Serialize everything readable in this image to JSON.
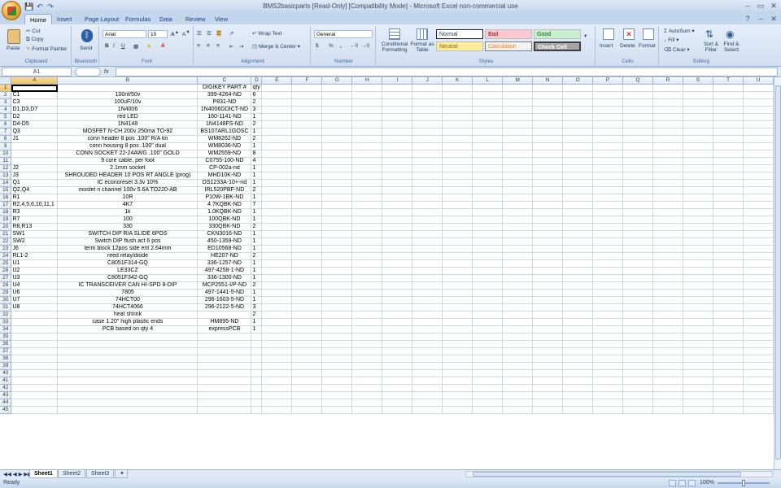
{
  "window": {
    "title": "BMS2basicparts  [Read-Only]  [Compatibility Mode] - Microsoft Excel non-commercial use",
    "minimize": "–",
    "maximize": "▭",
    "close": "✕"
  },
  "tabs": [
    "Home",
    "Insert",
    "Page Layout",
    "Formulas",
    "Data",
    "Review",
    "View"
  ],
  "active_tab": "Home",
  "ribbon": {
    "clipboard": {
      "label": "Clipboard",
      "paste": "Paste",
      "cut": "Cut",
      "copy": "Copy",
      "format_painter": "Format Painter"
    },
    "bluetooth": {
      "label": "Bluetooth",
      "send": "Send"
    },
    "font": {
      "label": "Font",
      "name": "Arial",
      "size": "10"
    },
    "alignment": {
      "label": "Alignment",
      "wrap": "Wrap Text",
      "merge": "Merge & Center"
    },
    "number": {
      "label": "Number",
      "format": "General",
      "currency": "$",
      "percent": "%",
      "comma": ","
    },
    "styles": {
      "label": "Styles",
      "conditional": "Conditional Formatting",
      "format_table": "Format as Table",
      "normal": "Normal",
      "bad": "Bad",
      "good": "Good",
      "neutral": "Neutral",
      "calculation": "Calculation",
      "check_cell": "Check Cell"
    },
    "cells": {
      "label": "Cells",
      "insert": "Insert",
      "delete": "Delete",
      "format": "Format"
    },
    "editing": {
      "label": "Editing",
      "autosum": "AutoSum",
      "fill": "Fill",
      "clear": "Clear",
      "sort": "Sort & Filter",
      "find": "Find & Select"
    }
  },
  "formula_bar": {
    "name_box": "A1",
    "fx": "fx",
    "value": ""
  },
  "columns": [
    "A",
    "B",
    "C",
    "D",
    "E",
    "F",
    "G",
    "H",
    "I",
    "J",
    "K",
    "L",
    "M",
    "N",
    "O",
    "P",
    "Q",
    "R",
    "S",
    "T",
    "U"
  ],
  "rows": [
    [
      "",
      "",
      "DIGIKEY PART #",
      "qty"
    ],
    [
      "C1",
      "100nf/50v",
      "399-4264-ND",
      "6"
    ],
    [
      "C3",
      "100uF/10v",
      "P831-ND",
      "2"
    ],
    [
      "D1,D3,D7",
      "1N4006",
      "1N4006GDICT-ND",
      "3"
    ],
    [
      "D2",
      "red LED",
      "160-1141-ND",
      "1"
    ],
    [
      "D4-D5",
      "1N4148",
      "1N4148FS-ND",
      "2"
    ],
    [
      "Q3",
      "MOSFET N-CH 200v 250ma TO-92",
      "BS107ARL1GOSC",
      "1"
    ],
    [
      "J1",
      "conn header 8 pos .100\" R/A tin",
      "WM8262-ND",
      "2"
    ],
    [
      "",
      "conn housing 8 pos .100\" dual",
      "WM8036-ND",
      "1"
    ],
    [
      "",
      "CONN SOCKET 22-24AWG .100\" GOLD",
      "WM2559-ND",
      "8"
    ],
    [
      "",
      "9 core cable, per foot",
      "C0755-100-ND",
      "4"
    ],
    [
      "J2",
      "2.1mm socket",
      "CP-002a-nd",
      "1"
    ],
    [
      "J3",
      "SHROUDED HEADER 10 POS RT ANGLE (prog)",
      "MHD10K-ND",
      "1"
    ],
    [
      "Q1",
      "IC econoreset 3.3v 10%",
      "DS1233A-10+-nd",
      "1"
    ],
    [
      "Q2,Q4",
      "mosfet n channel 100v 5.6A TO220-AB",
      "IRL520PBF-ND",
      "2"
    ],
    [
      "R1",
      "10R",
      "P10W-1BK-ND",
      "1"
    ],
    [
      "R2,4,5,6,10,11,1",
      "4K7",
      "4.7KQBK-ND",
      "7"
    ],
    [
      "R3",
      "1k",
      "1.0KQBK-ND",
      "1"
    ],
    [
      "R7",
      "100",
      "100QBK-ND",
      "1"
    ],
    [
      "R8,R13",
      "330",
      "330QBK-ND",
      "2"
    ],
    [
      "SW1",
      "SWITCH DIP R/A SLIDE 6POS",
      "CKN3016-ND",
      "1"
    ],
    [
      "SW2",
      "Switch DIP flush act 6 pos",
      "450-1359-ND",
      "1"
    ],
    [
      "J6",
      "term block 12pos side ent 2.64mm",
      "ED10568-ND",
      "1"
    ],
    [
      "RL1-2",
      "reed relay/diode",
      "HE207-ND",
      "2"
    ],
    [
      "U1",
      "C8051F314-GQ",
      "336-1257-ND",
      "1"
    ],
    [
      "U2",
      "LE33CZ",
      "497-4258-1-ND",
      "1"
    ],
    [
      "U3",
      "C8051F342-GQ",
      "336-1300-ND",
      "1"
    ],
    [
      "U4",
      "IC TRANSCEIVER CAN HI-SPD 8-DIP",
      "MCP2551-I/P-ND",
      "2"
    ],
    [
      "U6",
      "7805",
      "497-1441-5-ND",
      "1"
    ],
    [
      "U7",
      "74HCT00",
      "296-1603-5-ND",
      "1"
    ],
    [
      "U8",
      "74HCT4066",
      "296-2122-5-ND",
      "3"
    ],
    [
      "",
      "heat shrink",
      "",
      "2"
    ],
    [
      "",
      "case 1.20\" high plastic ends",
      "HM895-ND",
      "1"
    ],
    [
      "",
      "PCB based on qty 4",
      "expressPCB",
      "1"
    ]
  ],
  "total_rows": 45,
  "sheets": [
    "Sheet1",
    "Sheet2",
    "Sheet3"
  ],
  "active_sheet": "Sheet1",
  "status": {
    "ready": "Ready",
    "zoom": "100%"
  },
  "colors": {
    "accent": "#15428b",
    "grid": "#d0d7e5",
    "header": "#dfe7f1"
  }
}
